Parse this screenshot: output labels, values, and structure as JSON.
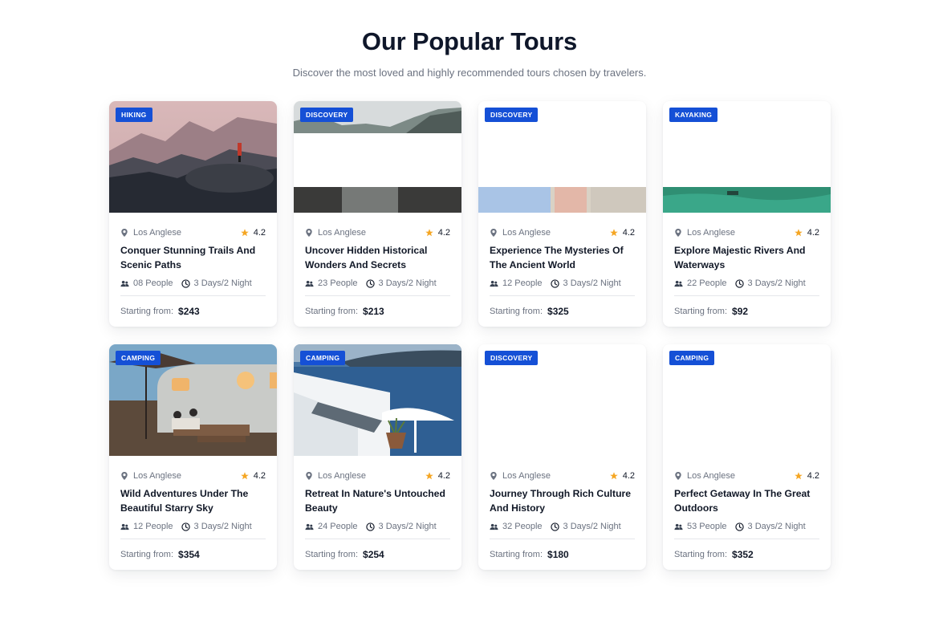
{
  "section": {
    "title": "Our Popular Tours",
    "subtitle": "Discover the most loved and highly recommended tours chosen by travelers."
  },
  "icons": {
    "location": "map-pin",
    "rating": "star",
    "people": "people",
    "duration": "clock"
  },
  "colors": {
    "badge": "#1550d6",
    "star": "#f5a623",
    "title": "#0f172a"
  },
  "tours": [
    {
      "badge": "HIKING",
      "location": "Los Anglese",
      "rating": "4.2",
      "name": "Conquer Stunning Trails And Scenic Paths",
      "people": "08 People",
      "duration": "3 Days/2 Night",
      "price_label": "Starting from:",
      "price": "$243"
    },
    {
      "badge": "DISCOVERY",
      "location": "Los Anglese",
      "rating": "4.2",
      "name": "Uncover Hidden Historical Wonders And Secrets",
      "people": "23 People",
      "duration": "3 Days/2 Night",
      "price_label": "Starting from:",
      "price": "$213"
    },
    {
      "badge": "DISCOVERY",
      "location": "Los Anglese",
      "rating": "4.2",
      "name": "Experience The Mysteries Of The Ancient World",
      "people": "12 People",
      "duration": "3 Days/2 Night",
      "price_label": "Starting from:",
      "price": "$325"
    },
    {
      "badge": "KAYAKING",
      "location": "Los Anglese",
      "rating": "4.2",
      "name": "Explore Majestic Rivers And Waterways",
      "people": "22 People",
      "duration": "3 Days/2 Night",
      "price_label": "Starting from:",
      "price": "$92"
    },
    {
      "badge": "CAMPING",
      "location": "Los Anglese",
      "rating": "4.2",
      "name": "Wild Adventures Under The Beautiful Starry Sky",
      "people": "12 People",
      "duration": "3 Days/2 Night",
      "price_label": "Starting from:",
      "price": "$354"
    },
    {
      "badge": "CAMPING",
      "location": "Los Anglese",
      "rating": "4.2",
      "name": "Retreat In Nature's Untouched Beauty",
      "people": "24 People",
      "duration": "3 Days/2 Night",
      "price_label": "Starting from:",
      "price": "$254"
    },
    {
      "badge": "DISCOVERY",
      "location": "Los Anglese",
      "rating": "4.2",
      "name": "Journey Through Rich Culture And History",
      "people": "32 People",
      "duration": "3 Days/2 Night",
      "price_label": "Starting from:",
      "price": "$180"
    },
    {
      "badge": "CAMPING",
      "location": "Los Anglese",
      "rating": "4.2",
      "name": "Perfect Getaway In The Great Outdoors",
      "people": "53 People",
      "duration": "3 Days/2 Night",
      "price_label": "Starting from:",
      "price": "$352"
    }
  ]
}
